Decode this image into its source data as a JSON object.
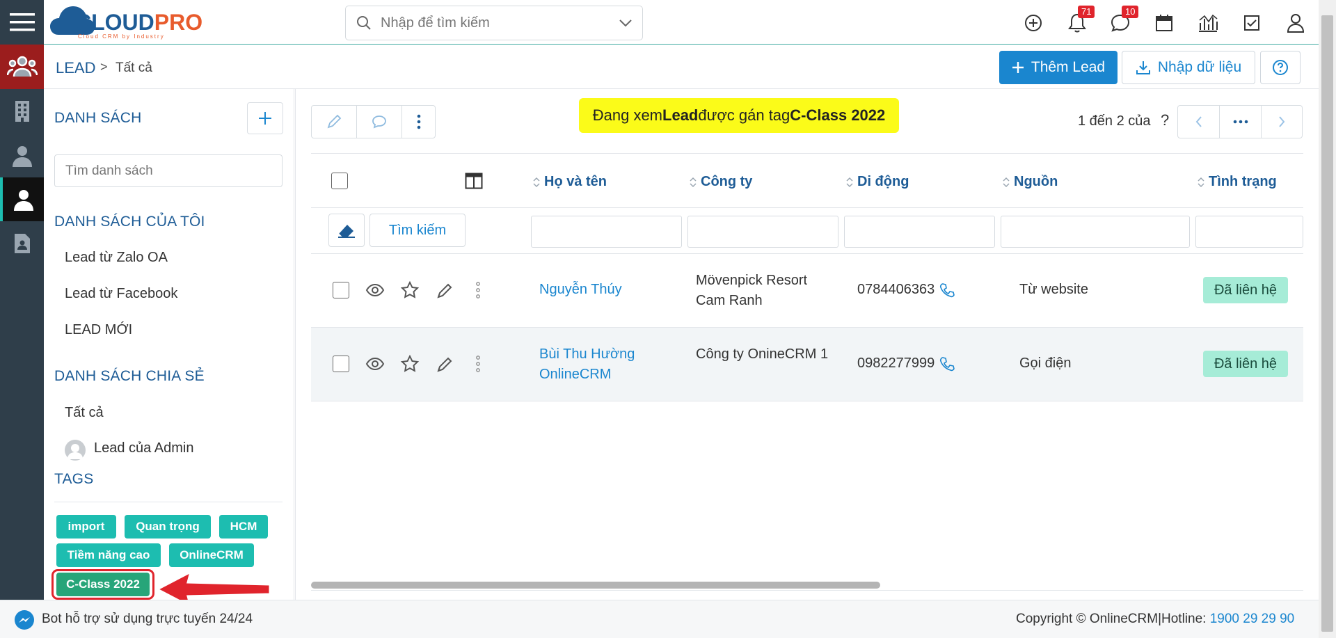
{
  "app": {
    "logo_text": "CLOUD",
    "logo_text2": "PRO",
    "logo_sub": "Cloud CRM by Industry"
  },
  "search": {
    "placeholder": "Nhập để tìm kiếm"
  },
  "topbar": {
    "notifications_count": "71",
    "messages_count": "10"
  },
  "breadcrumb": {
    "module": "LEAD",
    "separator": ">",
    "current": "Tất cả"
  },
  "actions": {
    "add_lead": "Thêm Lead",
    "import": "Nhập dữ liệu"
  },
  "sidebar": {
    "list_title": "DANH SÁCH",
    "list_search_placeholder": "Tìm danh sách",
    "my_lists_title": "DANH SÁCH CỦA TÔI",
    "my_lists": [
      "Lead từ Zalo OA",
      "Lead từ Facebook",
      "LEAD MỚI"
    ],
    "shared_title": "DANH SÁCH CHIA SẺ",
    "shared_lists": [
      "Tất cả",
      "Lead của Admin"
    ],
    "tags_title": "TAGS",
    "tags": [
      "import",
      "Quan trọng",
      "HCM",
      "Tiềm năng cao",
      "OnlineCRM",
      "C-Class 2022"
    ]
  },
  "notice": {
    "prefix": "Đang xem ",
    "module": "Lead",
    "middle": " được gán tag ",
    "tag": "C-Class 2022"
  },
  "pagination": {
    "label": "1 đến 2 của",
    "unknown": "?"
  },
  "table": {
    "search_button": "Tìm kiếm",
    "columns": [
      "Họ và tên",
      "Công ty",
      "Di động",
      "Nguồn",
      "Tình trạng"
    ],
    "rows": [
      {
        "name": "Nguyễn Thúy",
        "company": "Mövenpick Resort Cam Ranh",
        "mobile": "0784406363",
        "source": "Từ website",
        "status": "Đã liên hệ"
      },
      {
        "name": "Bùi Thu Hường OnlineCRM",
        "company": "Công ty OnineCRM 1",
        "mobile": "0982277999",
        "source": "Gọi điện",
        "status": "Đã liên hệ"
      }
    ]
  },
  "footer": {
    "bot_text": "Bot hỗ trợ sử dụng trực tuyến 24/24",
    "copyright": "Copyright © OnlineCRM",
    "hotline_label": "|Hotline: ",
    "hotline": "1900 29 29 90"
  },
  "colors": {
    "primary": "#1a86cf",
    "tag": "#1dbdb0",
    "notice": "#fbfb19",
    "status": "#a6ecd7",
    "rail": "#2f3e4a",
    "rail_active": "#9b1d1d"
  }
}
